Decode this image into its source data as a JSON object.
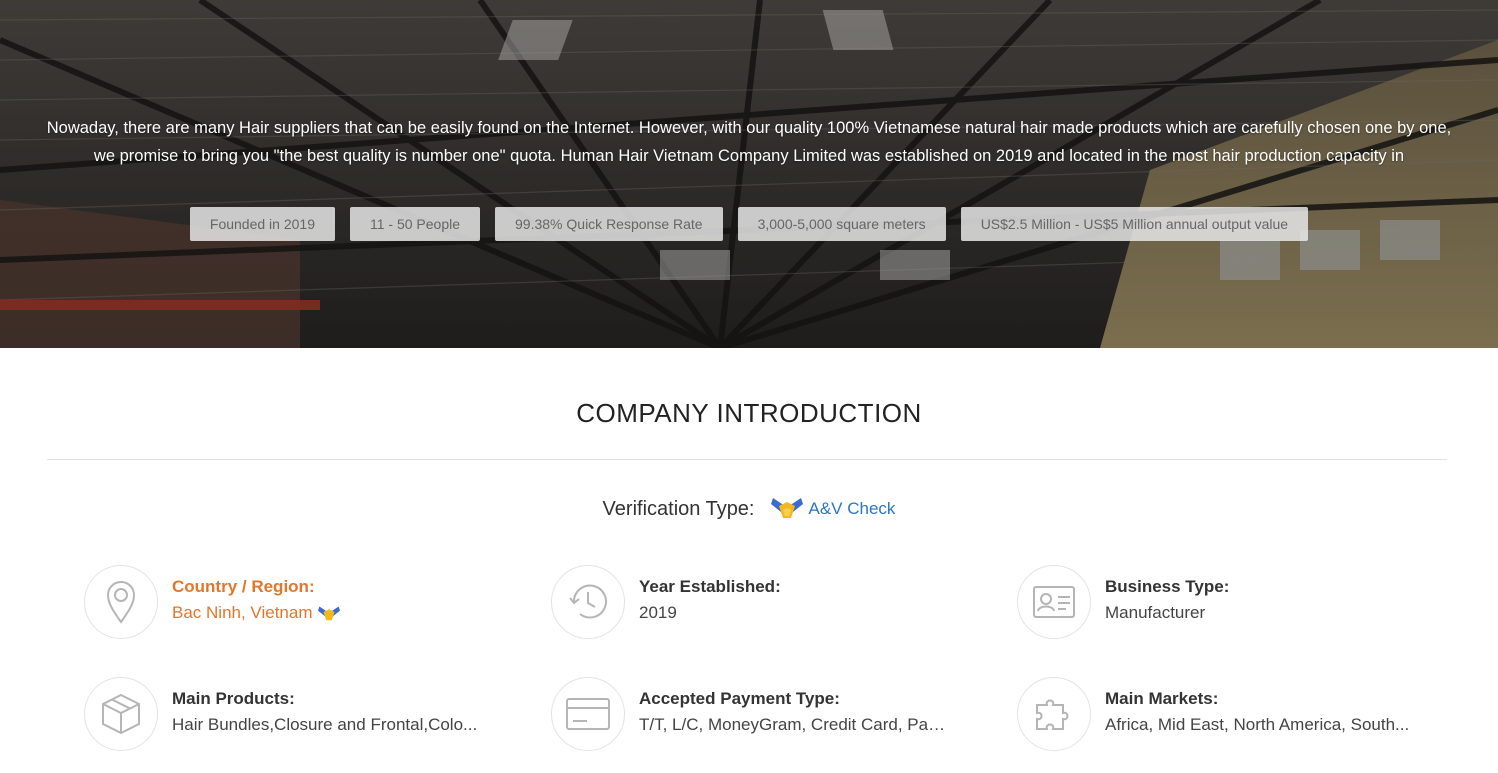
{
  "hero": {
    "description": "Nowaday, there are many Hair suppliers that can be easily found on the Internet. However, with our quality 100% Vietnamese natural hair made products which are carefully chosen one by one, we promise to bring you \"the best quality is number one\" quota. Human Hair Vietnam Company Limited was established on 2019 and located in the most hair production capacity in",
    "tags": [
      "Founded in 2019",
      "11 - 50 People",
      "99.38% Quick Response Rate",
      "3,000-5,000 square meters",
      "US$2.5 Million - US$5 Million annual output value"
    ]
  },
  "intro": {
    "title": "COMPANY INTRODUCTION",
    "verification_label": "Verification Type:",
    "verification_value": "A&V Check",
    "verification_icon": "handshake-badge-icon",
    "link_color": "#2a76c9",
    "accent_color": "#e4762a"
  },
  "details": [
    {
      "label": "Country / Region:",
      "value": "Bac Ninh, Vietnam",
      "icon": "location-pin-icon"
    },
    {
      "label": "Year Established:",
      "value": "2019",
      "icon": "history-clock-icon"
    },
    {
      "label": "Business Type:",
      "value": "Manufacturer",
      "icon": "id-card-icon"
    },
    {
      "label": "Main Products:",
      "value": "Hair Bundles,Closure and Frontal,Colo...",
      "icon": "box-cube-icon"
    },
    {
      "label": "Accepted Payment Type:",
      "value": "T/T, L/C, MoneyGram, Credit Card, Pay...",
      "icon": "credit-card-icon"
    },
    {
      "label": "Main Markets:",
      "value": "Africa, Mid East, North America, South...",
      "icon": "puzzle-piece-icon"
    }
  ]
}
